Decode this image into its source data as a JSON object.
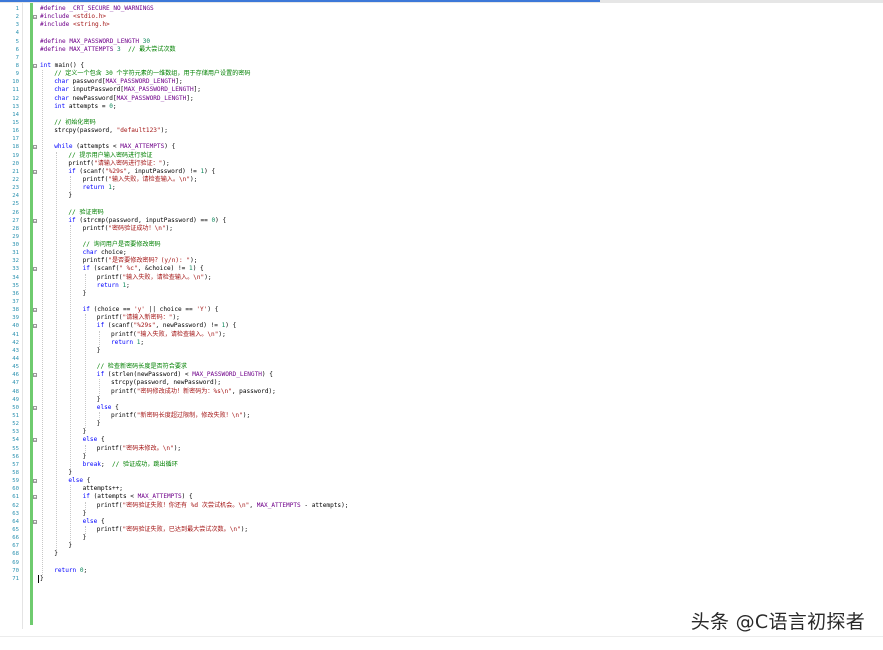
{
  "editor": {
    "lines": [
      {
        "n": "1",
        "indent": 0,
        "fold": "",
        "tokens": [
          [
            "mac",
            "#define _CRT_SECURE_NO_WARNINGS"
          ]
        ]
      },
      {
        "n": "2",
        "indent": 0,
        "fold": "−",
        "tokens": [
          [
            "mac",
            "#include "
          ],
          [
            "str",
            "<stdio.h>"
          ]
        ]
      },
      {
        "n": "3",
        "indent": 0,
        "fold": "",
        "tokens": [
          [
            "mac",
            "#include "
          ],
          [
            "str",
            "<string.h>"
          ]
        ]
      },
      {
        "n": "4",
        "indent": 0,
        "fold": "",
        "tokens": []
      },
      {
        "n": "5",
        "indent": 0,
        "fold": "",
        "tokens": [
          [
            "mac",
            "#define MAX_PASSWORD_LENGTH "
          ],
          [
            "num",
            "30"
          ]
        ]
      },
      {
        "n": "6",
        "indent": 0,
        "fold": "",
        "tokens": [
          [
            "mac",
            "#define MAX_ATTEMPTS "
          ],
          [
            "num",
            "3"
          ],
          [
            "pl",
            "  "
          ],
          [
            "cmt",
            "// 最大尝试次数"
          ]
        ]
      },
      {
        "n": "7",
        "indent": 0,
        "fold": "",
        "tokens": []
      },
      {
        "n": "8",
        "indent": 0,
        "fold": "−",
        "tokens": [
          [
            "kw",
            "int"
          ],
          [
            "pl",
            " main() {"
          ]
        ]
      },
      {
        "n": "9",
        "indent": 1,
        "fold": "",
        "tokens": [
          [
            "cmt",
            "// 定义一个包含 30 个字符元素的一维数组，用于存储用户设置的密码"
          ]
        ]
      },
      {
        "n": "10",
        "indent": 1,
        "fold": "",
        "tokens": [
          [
            "kw",
            "char"
          ],
          [
            "pl",
            " password["
          ],
          [
            "mac",
            "MAX_PASSWORD_LENGTH"
          ],
          [
            "pl",
            "];"
          ]
        ]
      },
      {
        "n": "11",
        "indent": 1,
        "fold": "",
        "tokens": [
          [
            "kw",
            "char"
          ],
          [
            "pl",
            " inputPassword["
          ],
          [
            "mac",
            "MAX_PASSWORD_LENGTH"
          ],
          [
            "pl",
            "];"
          ]
        ]
      },
      {
        "n": "12",
        "indent": 1,
        "fold": "",
        "tokens": [
          [
            "kw",
            "char"
          ],
          [
            "pl",
            " newPassword["
          ],
          [
            "mac",
            "MAX_PASSWORD_LENGTH"
          ],
          [
            "pl",
            "];"
          ]
        ]
      },
      {
        "n": "13",
        "indent": 1,
        "fold": "",
        "tokens": [
          [
            "kw",
            "int"
          ],
          [
            "pl",
            " attempts = "
          ],
          [
            "num",
            "0"
          ],
          [
            "pl",
            ";"
          ]
        ]
      },
      {
        "n": "14",
        "indent": 0,
        "fold": "",
        "tokens": []
      },
      {
        "n": "15",
        "indent": 1,
        "fold": "",
        "tokens": [
          [
            "cmt",
            "// 初始化密码"
          ]
        ]
      },
      {
        "n": "16",
        "indent": 1,
        "fold": "",
        "tokens": [
          [
            "pl",
            "strcpy(password, "
          ],
          [
            "str",
            "\"default123\""
          ],
          [
            "pl",
            ");"
          ]
        ]
      },
      {
        "n": "17",
        "indent": 0,
        "fold": "",
        "tokens": []
      },
      {
        "n": "18",
        "indent": 1,
        "fold": "−",
        "tokens": [
          [
            "kw",
            "while"
          ],
          [
            "pl",
            " (attempts < "
          ],
          [
            "mac",
            "MAX_ATTEMPTS"
          ],
          [
            "pl",
            ") {"
          ]
        ]
      },
      {
        "n": "19",
        "indent": 2,
        "fold": "",
        "tokens": [
          [
            "cmt",
            "// 提示用户输入密码进行验证"
          ]
        ]
      },
      {
        "n": "20",
        "indent": 2,
        "fold": "",
        "tokens": [
          [
            "pl",
            "printf("
          ],
          [
            "str",
            "\"请输入密码进行验证：\""
          ],
          [
            "pl",
            ");"
          ]
        ]
      },
      {
        "n": "21",
        "indent": 2,
        "fold": "−",
        "tokens": [
          [
            "kw",
            "if"
          ],
          [
            "pl",
            " (scanf("
          ],
          [
            "str",
            "\"%29s\""
          ],
          [
            "pl",
            ", inputPassword) != "
          ],
          [
            "num",
            "1"
          ],
          [
            "pl",
            ") {"
          ]
        ]
      },
      {
        "n": "22",
        "indent": 3,
        "fold": "",
        "tokens": [
          [
            "pl",
            "printf("
          ],
          [
            "str",
            "\"输入失败，请检查输入。\\n\""
          ],
          [
            "pl",
            ");"
          ]
        ]
      },
      {
        "n": "23",
        "indent": 3,
        "fold": "",
        "tokens": [
          [
            "kw",
            "return"
          ],
          [
            "pl",
            " "
          ],
          [
            "num",
            "1"
          ],
          [
            "pl",
            ";"
          ]
        ]
      },
      {
        "n": "24",
        "indent": 2,
        "fold": "",
        "tokens": [
          [
            "pl",
            "}"
          ]
        ]
      },
      {
        "n": "25",
        "indent": 0,
        "fold": "",
        "tokens": []
      },
      {
        "n": "26",
        "indent": 2,
        "fold": "",
        "tokens": [
          [
            "cmt",
            "// 验证密码"
          ]
        ]
      },
      {
        "n": "27",
        "indent": 2,
        "fold": "−",
        "tokens": [
          [
            "kw",
            "if"
          ],
          [
            "pl",
            " (strcmp(password, inputPassword) == "
          ],
          [
            "num",
            "0"
          ],
          [
            "pl",
            ") {"
          ]
        ]
      },
      {
        "n": "28",
        "indent": 3,
        "fold": "",
        "tokens": [
          [
            "pl",
            "printf("
          ],
          [
            "str",
            "\"密码验证成功！\\n\""
          ],
          [
            "pl",
            ");"
          ]
        ]
      },
      {
        "n": "29",
        "indent": 0,
        "fold": "",
        "tokens": []
      },
      {
        "n": "30",
        "indent": 3,
        "fold": "",
        "tokens": [
          [
            "cmt",
            "// 询问用户是否要修改密码"
          ]
        ]
      },
      {
        "n": "31",
        "indent": 3,
        "fold": "",
        "tokens": [
          [
            "kw",
            "char"
          ],
          [
            "pl",
            " choice;"
          ]
        ]
      },
      {
        "n": "32",
        "indent": 3,
        "fold": "",
        "tokens": [
          [
            "pl",
            "printf("
          ],
          [
            "str",
            "\"是否要修改密码？(y/n): \""
          ],
          [
            "pl",
            ");"
          ]
        ]
      },
      {
        "n": "33",
        "indent": 3,
        "fold": "−",
        "tokens": [
          [
            "kw",
            "if"
          ],
          [
            "pl",
            " (scanf("
          ],
          [
            "str",
            "\" %c\""
          ],
          [
            "pl",
            ", &choice) != "
          ],
          [
            "num",
            "1"
          ],
          [
            "pl",
            ") {"
          ]
        ]
      },
      {
        "n": "34",
        "indent": 4,
        "fold": "",
        "tokens": [
          [
            "pl",
            "printf("
          ],
          [
            "str",
            "\"输入失败，请检查输入。\\n\""
          ],
          [
            "pl",
            ");"
          ]
        ]
      },
      {
        "n": "35",
        "indent": 4,
        "fold": "",
        "tokens": [
          [
            "kw",
            "return"
          ],
          [
            "pl",
            " "
          ],
          [
            "num",
            "1"
          ],
          [
            "pl",
            ";"
          ]
        ]
      },
      {
        "n": "36",
        "indent": 3,
        "fold": "",
        "tokens": [
          [
            "pl",
            "}"
          ]
        ]
      },
      {
        "n": "37",
        "indent": 0,
        "fold": "",
        "tokens": []
      },
      {
        "n": "38",
        "indent": 3,
        "fold": "−",
        "tokens": [
          [
            "kw",
            "if"
          ],
          [
            "pl",
            " (choice == "
          ],
          [
            "str",
            "'y'"
          ],
          [
            "pl",
            " || choice == "
          ],
          [
            "str",
            "'Y'"
          ],
          [
            "pl",
            ") {"
          ]
        ]
      },
      {
        "n": "39",
        "indent": 4,
        "fold": "",
        "tokens": [
          [
            "pl",
            "printf("
          ],
          [
            "str",
            "\"请输入新密码：\""
          ],
          [
            "pl",
            ");"
          ]
        ]
      },
      {
        "n": "40",
        "indent": 4,
        "fold": "−",
        "tokens": [
          [
            "kw",
            "if"
          ],
          [
            "pl",
            " (scanf("
          ],
          [
            "str",
            "\"%29s\""
          ],
          [
            "pl",
            ", newPassword) != "
          ],
          [
            "num",
            "1"
          ],
          [
            "pl",
            ") {"
          ]
        ]
      },
      {
        "n": "41",
        "indent": 5,
        "fold": "",
        "tokens": [
          [
            "pl",
            "printf("
          ],
          [
            "str",
            "\"输入失败，请检查输入。\\n\""
          ],
          [
            "pl",
            ");"
          ]
        ]
      },
      {
        "n": "42",
        "indent": 5,
        "fold": "",
        "tokens": [
          [
            "kw",
            "return"
          ],
          [
            "pl",
            " "
          ],
          [
            "num",
            "1"
          ],
          [
            "pl",
            ";"
          ]
        ]
      },
      {
        "n": "43",
        "indent": 4,
        "fold": "",
        "tokens": [
          [
            "pl",
            "}"
          ]
        ]
      },
      {
        "n": "44",
        "indent": 0,
        "fold": "",
        "tokens": []
      },
      {
        "n": "45",
        "indent": 4,
        "fold": "",
        "tokens": [
          [
            "cmt",
            "// 检查新密码长度是否符合要求"
          ]
        ]
      },
      {
        "n": "46",
        "indent": 4,
        "fold": "−",
        "tokens": [
          [
            "kw",
            "if"
          ],
          [
            "pl",
            " (strlen(newPassword) < "
          ],
          [
            "mac",
            "MAX_PASSWORD_LENGTH"
          ],
          [
            "pl",
            ") {"
          ]
        ]
      },
      {
        "n": "47",
        "indent": 5,
        "fold": "",
        "tokens": [
          [
            "pl",
            "strcpy(password, newPassword);"
          ]
        ]
      },
      {
        "n": "48",
        "indent": 5,
        "fold": "",
        "tokens": [
          [
            "pl",
            "printf("
          ],
          [
            "str",
            "\"密码修改成功！新密码为：%s\\n\""
          ],
          [
            "pl",
            ", password);"
          ]
        ]
      },
      {
        "n": "49",
        "indent": 4,
        "fold": "",
        "tokens": [
          [
            "pl",
            "}"
          ]
        ]
      },
      {
        "n": "50",
        "indent": 4,
        "fold": "−",
        "tokens": [
          [
            "kw",
            "else"
          ],
          [
            "pl",
            " {"
          ]
        ]
      },
      {
        "n": "51",
        "indent": 5,
        "fold": "",
        "tokens": [
          [
            "pl",
            "printf("
          ],
          [
            "str",
            "\"新密码长度超过限制，修改失败！\\n\""
          ],
          [
            "pl",
            ");"
          ]
        ]
      },
      {
        "n": "52",
        "indent": 4,
        "fold": "",
        "tokens": [
          [
            "pl",
            "}"
          ]
        ]
      },
      {
        "n": "53",
        "indent": 3,
        "fold": "",
        "tokens": [
          [
            "pl",
            "}"
          ]
        ]
      },
      {
        "n": "54",
        "indent": 3,
        "fold": "−",
        "tokens": [
          [
            "kw",
            "else"
          ],
          [
            "pl",
            " {"
          ]
        ]
      },
      {
        "n": "55",
        "indent": 4,
        "fold": "",
        "tokens": [
          [
            "pl",
            "printf("
          ],
          [
            "str",
            "\"密码未修改。\\n\""
          ],
          [
            "pl",
            ");"
          ]
        ]
      },
      {
        "n": "56",
        "indent": 3,
        "fold": "",
        "tokens": [
          [
            "pl",
            "}"
          ]
        ]
      },
      {
        "n": "57",
        "indent": 3,
        "fold": "",
        "tokens": [
          [
            "kw",
            "break"
          ],
          [
            "pl",
            ";  "
          ],
          [
            "cmt",
            "// 验证成功，跳出循环"
          ]
        ]
      },
      {
        "n": "58",
        "indent": 2,
        "fold": "",
        "tokens": [
          [
            "pl",
            "}"
          ]
        ]
      },
      {
        "n": "59",
        "indent": 2,
        "fold": "−",
        "tokens": [
          [
            "kw",
            "else"
          ],
          [
            "pl",
            " {"
          ]
        ]
      },
      {
        "n": "60",
        "indent": 3,
        "fold": "",
        "tokens": [
          [
            "pl",
            "attempts++;"
          ]
        ]
      },
      {
        "n": "61",
        "indent": 3,
        "fold": "−",
        "tokens": [
          [
            "kw",
            "if"
          ],
          [
            "pl",
            " (attempts < "
          ],
          [
            "mac",
            "MAX_ATTEMPTS"
          ],
          [
            "pl",
            ") {"
          ]
        ]
      },
      {
        "n": "62",
        "indent": 4,
        "fold": "",
        "tokens": [
          [
            "pl",
            "printf("
          ],
          [
            "str",
            "\"密码验证失败！你还有 %d 次尝试机会。\\n\""
          ],
          [
            "pl",
            ", "
          ],
          [
            "mac",
            "MAX_ATTEMPTS"
          ],
          [
            "pl",
            " - attempts);"
          ]
        ]
      },
      {
        "n": "63",
        "indent": 3,
        "fold": "",
        "tokens": [
          [
            "pl",
            "}"
          ]
        ]
      },
      {
        "n": "64",
        "indent": 3,
        "fold": "−",
        "tokens": [
          [
            "kw",
            "else"
          ],
          [
            "pl",
            " {"
          ]
        ]
      },
      {
        "n": "65",
        "indent": 4,
        "fold": "",
        "tokens": [
          [
            "pl",
            "printf("
          ],
          [
            "str",
            "\"密码验证失败，已达到最大尝试次数。\\n\""
          ],
          [
            "pl",
            ");"
          ]
        ]
      },
      {
        "n": "66",
        "indent": 3,
        "fold": "",
        "tokens": [
          [
            "pl",
            "}"
          ]
        ]
      },
      {
        "n": "67",
        "indent": 2,
        "fold": "",
        "tokens": [
          [
            "pl",
            "}"
          ]
        ]
      },
      {
        "n": "68",
        "indent": 1,
        "fold": "",
        "tokens": [
          [
            "pl",
            "}"
          ]
        ]
      },
      {
        "n": "69",
        "indent": 0,
        "fold": "",
        "tokens": []
      },
      {
        "n": "70",
        "indent": 1,
        "fold": "",
        "tokens": [
          [
            "kw",
            "return"
          ],
          [
            "pl",
            " "
          ],
          [
            "num",
            "0"
          ],
          [
            "pl",
            ";"
          ]
        ]
      },
      {
        "n": "71",
        "indent": 0,
        "fold": "",
        "tokens": [
          [
            "pl",
            "}"
          ]
        ]
      }
    ]
  },
  "watermark": {
    "text": "头条 @C语言初探者"
  },
  "colors": {
    "keyword": "#0000ff",
    "macro": "#6f008a",
    "string": "#a31515",
    "comment": "#008000",
    "line_number": "#2b91af",
    "change_bar": "#6fcb6f"
  }
}
